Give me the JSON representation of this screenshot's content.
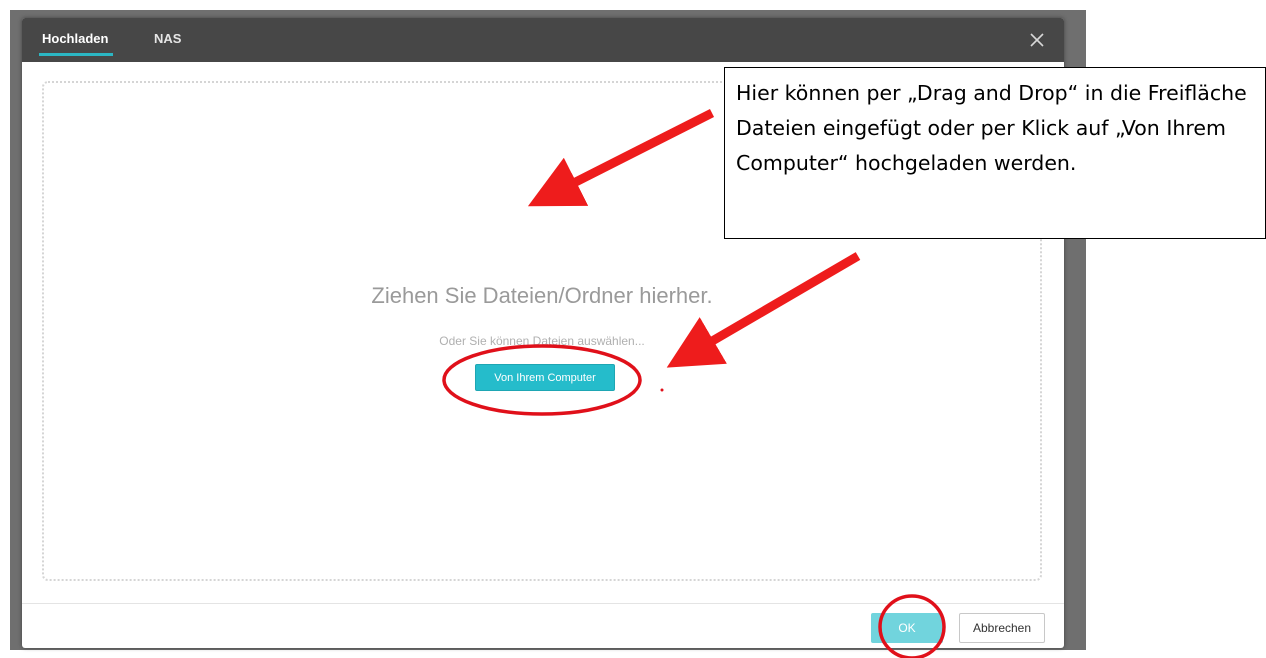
{
  "dialog": {
    "tabs": [
      {
        "label": "Hochladen",
        "active": true
      },
      {
        "label": "NAS",
        "active": false
      }
    ],
    "close_icon": "close-icon",
    "dropzone": {
      "title": "Ziehen Sie Dateien/Ordner hierher.",
      "subtitle": "Oder Sie können Dateien auswählen...",
      "button_label": "Von Ihrem Computer"
    },
    "footer": {
      "ok_label": "OK",
      "cancel_label": "Abbrechen"
    }
  },
  "annotation": {
    "callout_text": "Hier können per „Drag and Drop“ in die Freifläche Dateien eingefügt oder per Klick auf „Von Ihrem Computer“ hochgeladen werden.",
    "arrow_color": "#ee1c1c",
    "highlight_color": "#e0101a"
  },
  "colors": {
    "header": "#474747",
    "accent": "#25bccb",
    "tab_underline": "#2bb6c3"
  }
}
